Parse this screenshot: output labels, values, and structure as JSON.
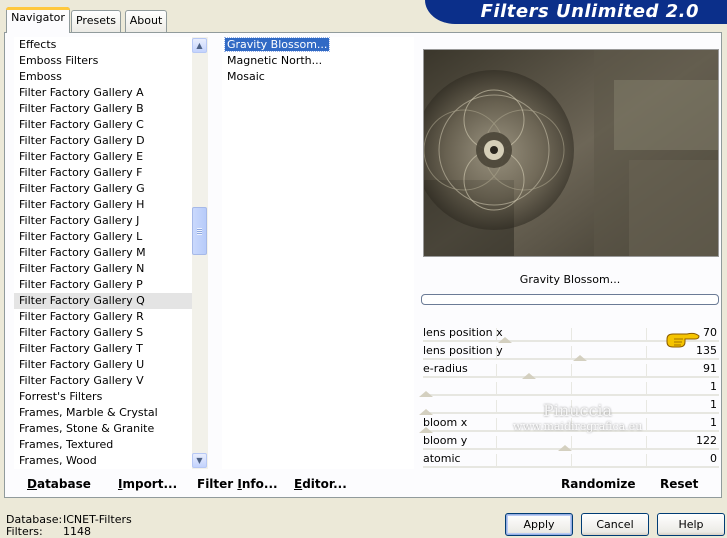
{
  "app_title": "Filters Unlimited 2.0",
  "tabs": [
    {
      "label": "Navigator",
      "active": true
    },
    {
      "label": "Presets",
      "active": false
    },
    {
      "label": "About",
      "active": false
    }
  ],
  "categories": {
    "items": [
      "Effects",
      "Emboss Filters",
      "Emboss",
      "Filter Factory Gallery A",
      "Filter Factory Gallery B",
      "Filter Factory Gallery C",
      "Filter Factory Gallery D",
      "Filter Factory Gallery E",
      "Filter Factory Gallery F",
      "Filter Factory Gallery G",
      "Filter Factory Gallery H",
      "Filter Factory Gallery J",
      "Filter Factory Gallery L",
      "Filter Factory Gallery M",
      "Filter Factory Gallery N",
      "Filter Factory Gallery P",
      "Filter Factory Gallery Q",
      "Filter Factory Gallery R",
      "Filter Factory Gallery S",
      "Filter Factory Gallery T",
      "Filter Factory Gallery U",
      "Filter Factory Gallery V",
      "Forrest's Filters",
      "Frames, Marble & Crystal",
      "Frames, Stone & Granite",
      "Frames, Textured",
      "Frames, Wood"
    ],
    "selected": "Filter Factory Gallery Q"
  },
  "filters": {
    "items": [
      "Gravity Blossom...",
      "Magnetic North...",
      "Mosaic"
    ],
    "selected": "Gravity Blossom..."
  },
  "actions": {
    "database": {
      "pre": "",
      "ul": "D",
      "post": "atabase"
    },
    "import": {
      "pre": "",
      "ul": "I",
      "post": "mport..."
    },
    "filter_info": {
      "pre": "Filter ",
      "ul": "I",
      "post": "nfo..."
    },
    "editor": {
      "pre": "",
      "ul": "E",
      "post": "ditor..."
    }
  },
  "preview": {
    "filter_name": "Gravity Blossom..."
  },
  "params": [
    {
      "label": "lens position x",
      "value": "70",
      "fraction": 0.275
    },
    {
      "label": "lens position y",
      "value": "135",
      "fraction": 0.53
    },
    {
      "label": "e-radius",
      "value": "91",
      "fraction": 0.357
    },
    {
      "label": "",
      "value": "1",
      "fraction": 0.004
    },
    {
      "label": "",
      "value": "1",
      "fraction": 0.004
    },
    {
      "label": "bloom x",
      "value": "1",
      "fraction": 0.004
    },
    {
      "label": "bloom y",
      "value": "122",
      "fraction": 0.478
    },
    {
      "label": "atomic",
      "value": "0",
      "fraction": null
    }
  ],
  "param_buttons": {
    "randomize": "Randomize",
    "reset": "Reset"
  },
  "status": {
    "database_label": "Database:",
    "database_value": "ICNET-Filters",
    "filters_label": "Filters:",
    "filters_value": "1148"
  },
  "dialog_buttons": {
    "apply": "Apply",
    "cancel": "Cancel",
    "help": "Help"
  },
  "watermark": {
    "line1": "Pinuccia",
    "line2": "www.maidiregrafica.eu"
  },
  "colors": {
    "banner": "#0b2f8a",
    "selection": "#316ac5",
    "pointer_hand": "#f5c400"
  }
}
